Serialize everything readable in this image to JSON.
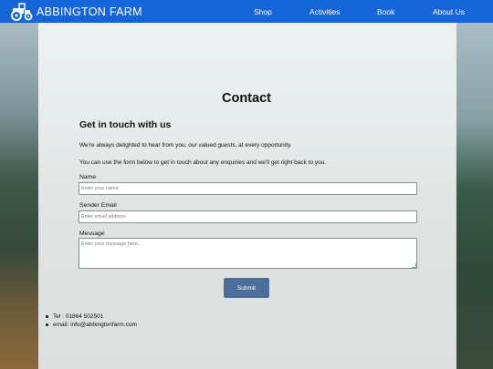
{
  "header": {
    "brand": "ABBINGTON FARM",
    "nav": [
      "Shop",
      "Activities",
      "Book",
      "About Us"
    ]
  },
  "page": {
    "title": "Contact",
    "subtitle": "Get in touch with us",
    "intro1": "We're always delighted to hear from you, our valued guests, at every opportunity.",
    "intro2": "You can use the form below to get in touch about any enquiries and we'll get right back to you."
  },
  "form": {
    "name_label": "Name",
    "name_placeholder": "Enter your name",
    "email_label": "Sender Email",
    "email_placeholder": "Enter email address",
    "message_label": "Message",
    "message_placeholder": "Enter your message here...",
    "submit_label": "Submit"
  },
  "contact": {
    "tel": "Tel : 01864 502501",
    "email": "email: info@abbingtonfarm.com"
  },
  "colors": {
    "navbar": "#1565d8",
    "submit": "#4b6f9a"
  }
}
